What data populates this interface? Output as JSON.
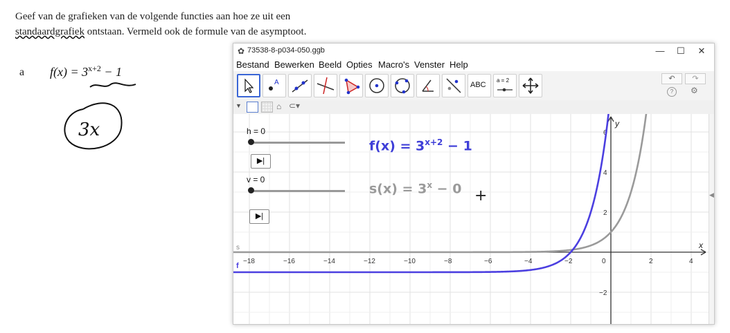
{
  "task": {
    "line1": "Geef van de grafieken van de volgende functies aan hoe ze uit een",
    "line2_underlined": "standaardgrafiek",
    "line2_rest": " ontstaan. Vermeld ook de formule van de asymptoot.",
    "item_label": "a",
    "formula_prefix": "f(x) = 3",
    "formula_exponent": "x+2",
    "formula_suffix": " − 1",
    "handwritten": "3x"
  },
  "window": {
    "title": "73538-8-p034-050.ggb",
    "minimize": "—",
    "maximize": "☐",
    "close": "✕"
  },
  "menu": [
    "Bestand",
    "Bewerken",
    "Beeld",
    "Opties",
    "Macro's",
    "Venster",
    "Help"
  ],
  "toolbar": {
    "tools": [
      "move-tool",
      "point-tool",
      "line-tool",
      "perpendicular-line-tool",
      "polygon-tool",
      "circle-tool",
      "circle-three-points-tool",
      "angle-tool",
      "reflect-tool",
      "text-tool",
      "slider-tool",
      "move-graphics-view-tool"
    ],
    "text_tool_label": "ABC",
    "slider_tool_label": "a = 2",
    "undo": "↶",
    "redo": "↷",
    "help": "?",
    "settings": "⚙"
  },
  "algebra": {
    "slider_h_label": "h = 0",
    "slider_v_label": "v = 0",
    "play_symbol": "▶|",
    "f_formula_main": "f(x)  =  3",
    "f_formula_exp": "x+2",
    "f_formula_tail": " − 1",
    "s_formula_main": "s(x)  =  3",
    "s_formula_exp": "x",
    "s_formula_tail": " − 0",
    "f_color": "#3f3fd8",
    "s_color": "#999999"
  },
  "graph": {
    "x_axis_label": "x",
    "y_axis_label": "y",
    "x_ticks": [
      "−18",
      "−16",
      "−14",
      "−12",
      "−10",
      "−8",
      "−6",
      "−4",
      "−2",
      "0",
      "2",
      "4"
    ],
    "y_ticks": [
      "6",
      "4",
      "2",
      "−2"
    ],
    "curve_f_label": "f",
    "curve_s_label": "s",
    "f_color": "#4b3fe0",
    "s_color": "#9a9a9a"
  }
}
